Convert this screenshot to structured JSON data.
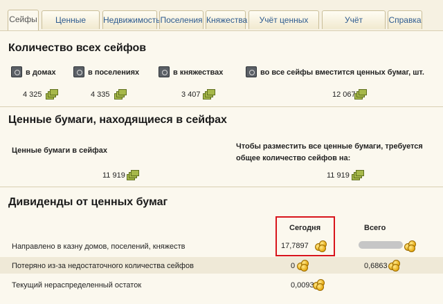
{
  "tabs": [
    "Сейфы",
    "Ценные бумаги",
    "Недвижимость",
    "Поселения",
    "Княжества",
    "Учёт ценных бумаг",
    "Учёт дивидендов",
    "Справка"
  ],
  "safes_section": {
    "title": "Количество всех сейфов",
    "labels": [
      "в домах",
      "в поселениях",
      "в княжествах",
      "во все сейфы вместится ценных бумаг, шт."
    ],
    "values": [
      "4 325",
      "4 335",
      "3 407",
      "12 067"
    ]
  },
  "securities_section": {
    "title": "Ценные бумаги, находящиеся в сейфах",
    "left_label": "Ценные бумаги в сейфах",
    "right_label": "Чтобы разместить все ценные бумаги, требуется общее количество сейфов на:",
    "left_value": "11 919",
    "right_value": "11 919"
  },
  "dividends_section": {
    "title": "Дивиденды от ценных бумаг",
    "col_today": "Сегодня",
    "col_total": "Всего",
    "rows": [
      {
        "label": "Направлено в казну домов, поселений, княжеств",
        "today": "17,7897",
        "total": ""
      },
      {
        "label": "Потеряно из-за недостаточного количества сейфов",
        "today": "0",
        "total": "0,6863"
      },
      {
        "label": "Текущий нераспределенный остаток",
        "today": "0,0093",
        "total": ""
      }
    ]
  },
  "icons": {
    "safe": "safe-icon",
    "bond": "bond-icon",
    "coin": "coins-icon"
  },
  "colors": {
    "tab_text": "#2c5a8f",
    "highlight_border": "#d8131b",
    "background": "#fbf8ee"
  }
}
